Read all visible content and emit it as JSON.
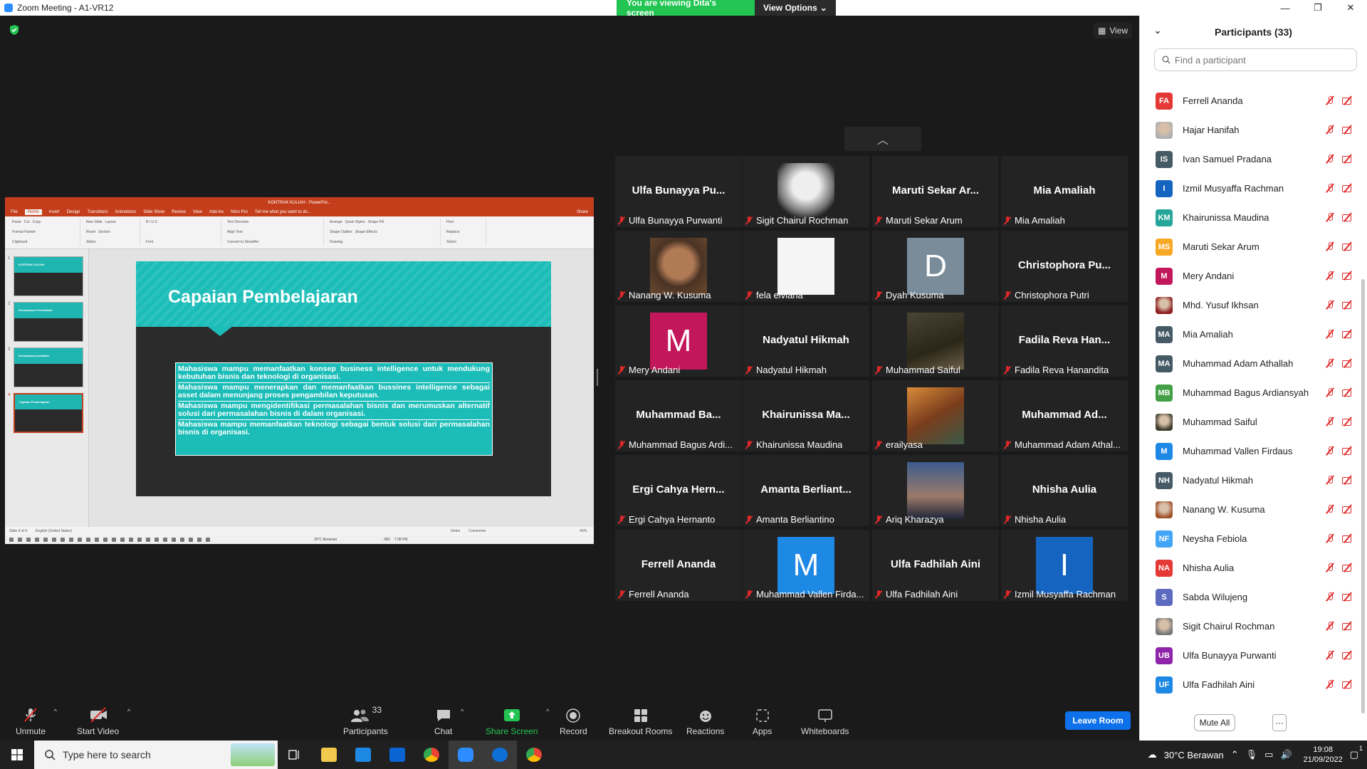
{
  "window": {
    "title": "Zoom Meeting - A1-VR12",
    "controls": [
      "—",
      "❐",
      "✕"
    ]
  },
  "banner": {
    "viewing": "You are viewing Dita's screen",
    "view_options": "View Options"
  },
  "view_button": "View",
  "shared_screen": {
    "window_title": "KONTRAK KULIAH - PowerPoi...",
    "tabs": [
      "File",
      "Home",
      "Insert",
      "Design",
      "Transitions",
      "Animations",
      "Slide Show",
      "Review",
      "View",
      "Add-ins",
      "Nitro Pro",
      "Tell me what you want to do..."
    ],
    "share_label": "Share",
    "ribbon_groups": [
      "Clipboard",
      "Slides",
      "Font",
      "Paragraph",
      "Drawing",
      "Editing"
    ],
    "ribbon_items": {
      "paste": "Paste",
      "cut": "Cut",
      "copy": "Copy",
      "format_painter": "Format Painter",
      "new_slide": "New Slide",
      "layout": "Layout",
      "reset": "Reset",
      "section": "Section",
      "find": "Find",
      "replace": "Replace",
      "select": "Select",
      "arrange": "Arrange",
      "quick_styles": "Quick Styles",
      "shape_fill": "Shape Fill",
      "shape_outline": "Shape Outline",
      "shape_effects": "Shape Effects",
      "text_direction": "Text Direction",
      "align_text": "Align Text",
      "convert_smartart": "Convert to SmartArt"
    },
    "thumbnails": [
      {
        "num": "1",
        "title": "KONTRAK KULIAH"
      },
      {
        "num": "2",
        "title": "Kemampuan Perkuliahan"
      },
      {
        "num": "3",
        "title": "Kemampuan praktikan"
      },
      {
        "num": "4",
        "title": "Capaian Pembelajaran"
      }
    ],
    "slide": {
      "heading": "Capaian Pembelajaran",
      "points": [
        "Mahasiswa mampu memanfaatkan konsep business intelligence untuk mendukung kebutuhan bisnis dan teknologi di organisasi.",
        "Mahasiswa mampu menerapkan dan memanfaatkan bussines intelligence sebagai asset dalam menunjang proses pengambilan keputusan.",
        "Mahasiswa mampu mengidentifikasi permasalahan bisnis dan merumuskan alternatif solusi dari permasalahan bisnis di dalam organisasi.",
        "Mahasiswa mampu memanfaatkan teknologi sebagai bentuk solusi dari permasalahan bisnis di organisasi."
      ]
    },
    "status": {
      "slide_of": "Slide 4 of 4",
      "language": "English (United States)",
      "notes": "Notes",
      "comments": "Comments",
      "zoom": "65%"
    },
    "inner_taskbar": {
      "weather": "30°C Berawan",
      "lang": "IND",
      "time": "7:08 PM"
    }
  },
  "gallery": [
    {
      "big": "Ulfa Bunayya Pu...",
      "name": "Ulfa Bunayya Purwanti"
    },
    {
      "big": "",
      "name": "Sigit Chairul Rochman",
      "photo": "sketch"
    },
    {
      "big": "Maruti Sekar Ar...",
      "name": "Maruti Sekar Arum"
    },
    {
      "big": "Mia Amaliah",
      "name": "Mia Amaliah"
    },
    {
      "big": "",
      "name": "Nanang W. Kusuma",
      "photo": "portrait"
    },
    {
      "big": "",
      "name": "fela elviana",
      "photo": "white"
    },
    {
      "big": "",
      "name": "Dyah Kusuma",
      "avatar": "D",
      "color": "#7a8c9a"
    },
    {
      "big": "Christophora Pu...",
      "name": "Christophora Putri"
    },
    {
      "big": "",
      "name": "Mery Andani",
      "avatar": "M",
      "color": "#c2185b"
    },
    {
      "big": "Nadyatul Hikmah",
      "name": "Nadyatul Hikmah"
    },
    {
      "big": "",
      "name": "Muhammad Saiful",
      "photo": "anime"
    },
    {
      "big": "Fadila Reva Han...",
      "name": "Fadila Reva Hanandita"
    },
    {
      "big": "Muhammad Ba...",
      "name": "Muhammad Bagus Ardi..."
    },
    {
      "big": "Khairunissa Ma...",
      "name": "Khairunissa Maudina"
    },
    {
      "big": "",
      "name": "erailyasa",
      "photo": "painting"
    },
    {
      "big": "Muhammad Ad...",
      "name": "Muhammad Adam Athal..."
    },
    {
      "big": "Ergi Cahya Hern...",
      "name": "Ergi Cahya Hernanto"
    },
    {
      "big": "Amanta Berliant...",
      "name": "Amanta Berliantino"
    },
    {
      "big": "",
      "name": "Ariq Kharazya",
      "photo": "sunset"
    },
    {
      "big": "Nhisha Aulia",
      "name": "Nhisha Aulia"
    },
    {
      "big": "Ferrell Ananda",
      "name": "Ferrell Ananda"
    },
    {
      "big": "",
      "name": "Muhammad Vallen Firda...",
      "avatar": "M",
      "color": "#1e88e5"
    },
    {
      "big": "Ulfa Fadhilah Aini",
      "name": "Ulfa Fadhilah Aini"
    },
    {
      "big": "",
      "name": "Izmil Musyaffa Rachman",
      "avatar": "I",
      "color": "#1565c0"
    }
  ],
  "panel": {
    "title": "Participants (33)",
    "search_placeholder": "Find a participant",
    "mute_all": "Mute All",
    "more": "···",
    "participants": [
      {
        "initials": "FA",
        "name": "Ferrell Ananda",
        "color": "#e53935"
      },
      {
        "initials": "",
        "name": "Hajar Hanifah",
        "color": "#b0b0b0",
        "photo": true
      },
      {
        "initials": "IS",
        "name": "Ivan Samuel Pradana",
        "color": "#455a64"
      },
      {
        "initials": "I",
        "name": "Izmil Musyaffa Rachman",
        "color": "#1565c0"
      },
      {
        "initials": "KM",
        "name": "Khairunissa Maudina",
        "color": "#26a69a"
      },
      {
        "initials": "MS",
        "name": "Maruti Sekar Arum",
        "color": "#f9a825"
      },
      {
        "initials": "M",
        "name": "Mery Andani",
        "color": "#c2185b"
      },
      {
        "initials": "",
        "name": "Mhd. Yusuf Ikhsan",
        "color": "#8d1f1f",
        "photo": true
      },
      {
        "initials": "MA",
        "name": "Mia Amaliah",
        "color": "#455a64"
      },
      {
        "initials": "MA",
        "name": "Muhammad Adam Athallah",
        "color": "#455a64"
      },
      {
        "initials": "MB",
        "name": "Muhammad Bagus Ardiansyah",
        "color": "#43a047"
      },
      {
        "initials": "",
        "name": "Muhammad Saiful",
        "color": "#3e3e2e",
        "photo": true
      },
      {
        "initials": "M",
        "name": "Muhammad Vallen Firdaus",
        "color": "#1e88e5"
      },
      {
        "initials": "NH",
        "name": "Nadyatul Hikmah",
        "color": "#455a64"
      },
      {
        "initials": "",
        "name": "Nanang W. Kusuma",
        "color": "#a0522d",
        "photo": true
      },
      {
        "initials": "NF",
        "name": "Neysha Febiola",
        "color": "#42a5f5"
      },
      {
        "initials": "NA",
        "name": "Nhisha Aulia",
        "color": "#e53935"
      },
      {
        "initials": "S",
        "name": "Sabda Wilujeng",
        "color": "#5c6bc0"
      },
      {
        "initials": "",
        "name": "Sigit Chairul Rochman",
        "color": "#777",
        "photo": true
      },
      {
        "initials": "UB",
        "name": "Ulfa Bunayya Purwanti",
        "color": "#8e24aa"
      },
      {
        "initials": "UF",
        "name": "Ulfa Fadhilah Aini",
        "color": "#1e88e5"
      }
    ]
  },
  "toolbar": {
    "unmute": "Unmute",
    "start_video": "Start Video",
    "participants": "Participants",
    "participants_count": "33",
    "chat": "Chat",
    "share_screen": "Share Screen",
    "record": "Record",
    "breakout_rooms": "Breakout Rooms",
    "reactions": "Reactions",
    "apps": "Apps",
    "whiteboards": "Whiteboards",
    "leave_room": "Leave Room"
  },
  "taskbar": {
    "search_placeholder": "Type here to search",
    "weather": "30°C Berawan",
    "time": "19:08",
    "date": "21/09/2022",
    "notifications": "1"
  }
}
